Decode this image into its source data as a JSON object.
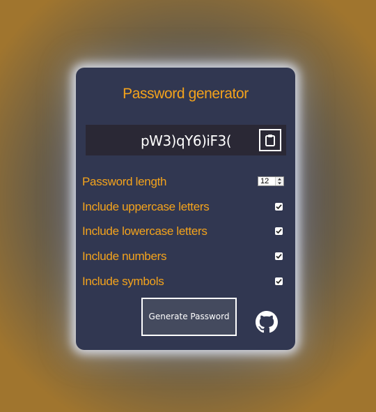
{
  "app": {
    "title": "Password generator"
  },
  "result": {
    "password": "pW3)qY6)iF3(",
    "copy_icon": "clipboard-icon"
  },
  "settings": {
    "length": {
      "label": "Password length",
      "value": "12"
    },
    "uppercase": {
      "label": "Include uppercase letters",
      "checked": true
    },
    "lowercase": {
      "label": "Include lowercase letters",
      "checked": true
    },
    "numbers": {
      "label": "Include numbers",
      "checked": true
    },
    "symbols": {
      "label": "Include symbols",
      "checked": true
    }
  },
  "actions": {
    "generate_label": "Generate Password",
    "github_icon": "github-icon"
  },
  "colors": {
    "accent": "#f4a31c",
    "card_background": "#313751",
    "result_background": "#2a2835",
    "button_background": "#444a5e"
  }
}
